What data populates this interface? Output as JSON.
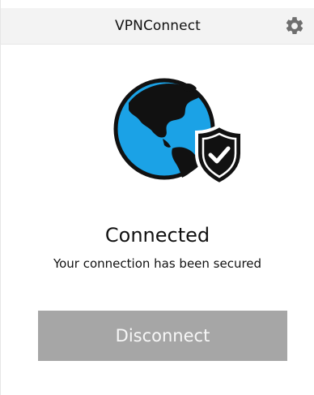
{
  "app": {
    "title": "VPNConnect"
  },
  "icons": {
    "settings": "gear-icon",
    "hero": "globe-shield-icon"
  },
  "colors": {
    "globe_ocean": "#1ba2e6",
    "globe_land": "#111111",
    "button_bg": "#a6a6a6",
    "titlebar_bg": "#f3f3f3"
  },
  "status": {
    "label": "Connected",
    "message": "Your connection has been secured"
  },
  "actions": {
    "disconnect_label": "Disconnect"
  }
}
